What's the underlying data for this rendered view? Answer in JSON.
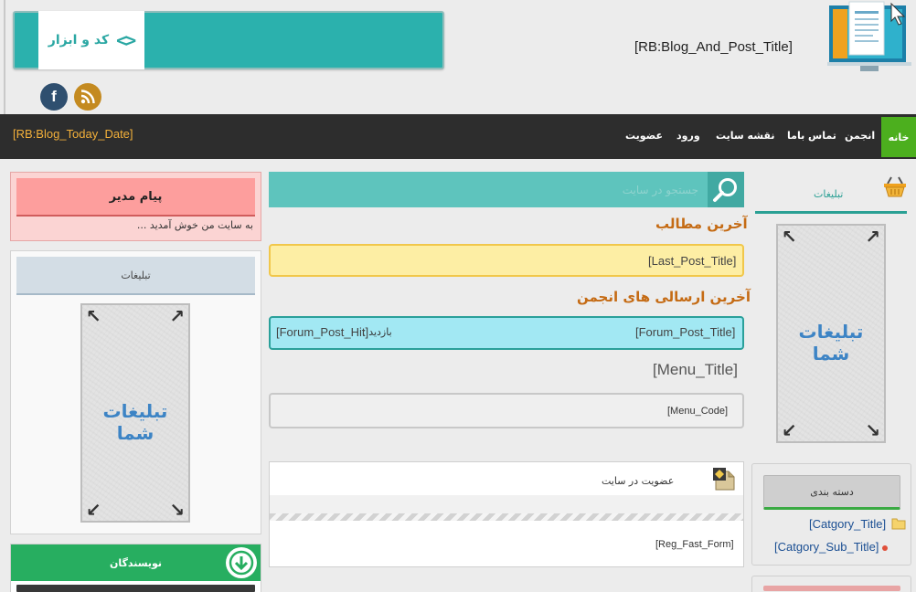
{
  "header": {
    "ad_banner_label": "کد و ابزار",
    "ad_banner_code_icon": "chevrons-code-icon",
    "blog_title": "[RB:Blog_And_Post_Title]",
    "social": [
      "facebook-icon",
      "rss-icon"
    ],
    "facebook_glyph": "f"
  },
  "navbar": {
    "date": "[RB:Blog_Today_Date]",
    "home": "خانه",
    "items": [
      "انجمن",
      "تماس باما",
      "نقشه سایت",
      "ورود",
      "عضویت"
    ],
    "accent": "#4caf1e"
  },
  "right_sidebar": {
    "ads_title": "تبلیغات",
    "ad_text": "تبلیغات شما",
    "categories": {
      "title": "دسته بندی",
      "category": "[Catgory_Title]",
      "sub_category": "[Catgory_Sub_Title]"
    }
  },
  "main": {
    "search_placeholder": "جستجو در سایت",
    "latest_posts_title": "آخرین مطالب",
    "last_post": "[Last_Post_Title]",
    "forum_title": "آخرین ارسالی های انجمن",
    "forum_post": "[Forum_Post_Title]",
    "forum_visits_label": "بازدید :",
    "forum_hits": "[Forum_Post_Hit]",
    "menu_title": "[Menu_Title]",
    "menu_code": "[Menu_Code]",
    "register": {
      "title": "عضویت در سایت",
      "form": "[Reg_Fast_Form]"
    }
  },
  "left_column": {
    "admin_message": {
      "title": "پیام مدیر",
      "text": "به سایت من خوش آمدید ..."
    },
    "ads_title": "تبلیغات",
    "ad_text": "تبلیغات شما",
    "authors_title": "نویسندگان"
  },
  "colors": {
    "teal": "#2bb1ad",
    "navbar": "#2d2d2d",
    "date_orange": "#f3b03a",
    "section_title": "#c56b14",
    "post_yellow": "#fdeea4",
    "forum_cyan": "#a2e8f3",
    "admin_red": "#fd9e9d",
    "authors_green": "#27ae60"
  }
}
